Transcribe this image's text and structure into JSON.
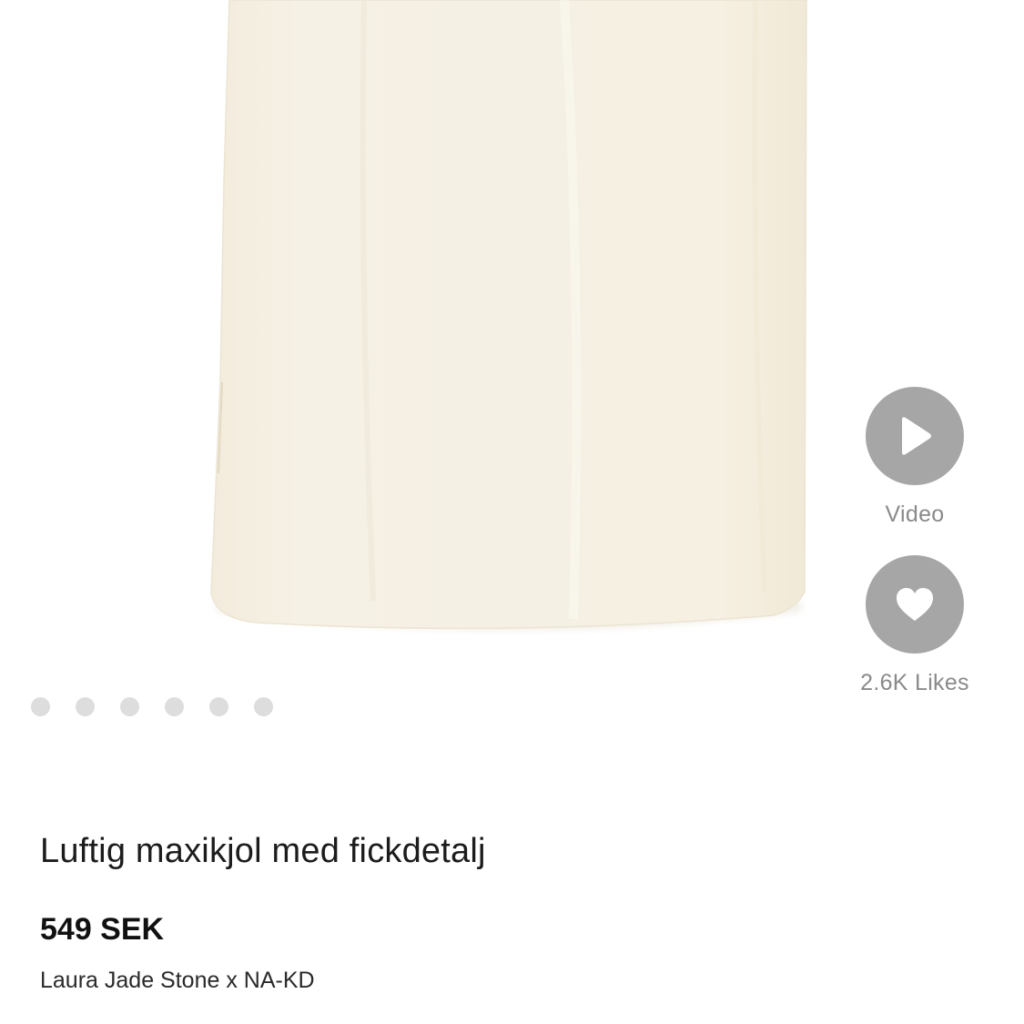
{
  "gallery": {
    "dot_count": 6,
    "dress_color": "#f6f1e6"
  },
  "actions": {
    "video": {
      "label": "Video",
      "icon": "play-icon"
    },
    "likes": {
      "label": "2.6K Likes",
      "icon": "heart-icon"
    }
  },
  "product": {
    "title": "Luftig maxikjol med fickdetalj",
    "price": "549 SEK",
    "brand": "Laura Jade Stone x NA-KD"
  },
  "colors": {
    "action_button_bg": "#a6a6a6",
    "action_label": "#8a8a8a",
    "dot_inactive": "#dddddd"
  }
}
